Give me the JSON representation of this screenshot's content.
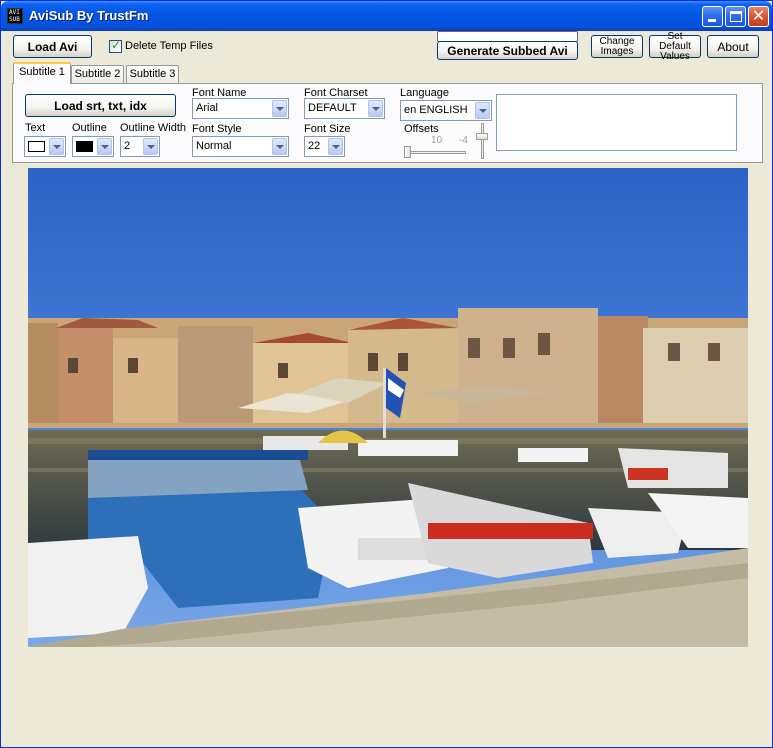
{
  "window": {
    "title": "AviSub By TrustFm",
    "icon_text": "AVI SUB"
  },
  "toolbar": {
    "load_avi": "Load Avi",
    "delete_temp_files": "Delete Temp Files",
    "delete_temp_files_checked": true,
    "generate": "Generate Subbed Avi",
    "change_images": "Change Images",
    "set_default_values": "Set Default Values",
    "about": "About"
  },
  "tabs": [
    "Subtitle 1",
    "Subtitle 2",
    "Subtitle 3"
  ],
  "subtitle": {
    "load_button": "Load srt, txt, idx",
    "text_label": "Text",
    "outline_label": "Outline",
    "outline_width_label": "Outline Width",
    "outline_width_value": "2",
    "text_color": "#FFFFFF",
    "outline_color": "#000000",
    "font_name_label": "Font Name",
    "font_name_value": "Arial",
    "font_style_label": "Font Style",
    "font_style_value": "Normal",
    "font_charset_label": "Font Charset",
    "font_charset_value": "DEFAULT",
    "font_size_label": "Font Size",
    "font_size_value": "22",
    "language_label": "Language",
    "language_value": "en ENGLISH",
    "offsets_label": "Offsets",
    "offset_x": "10",
    "offset_y": "-4"
  },
  "colors": {
    "titlebar": "#0454E2",
    "window_bg": "#ECE9D8",
    "tab_highlight": "#FFC83C"
  }
}
